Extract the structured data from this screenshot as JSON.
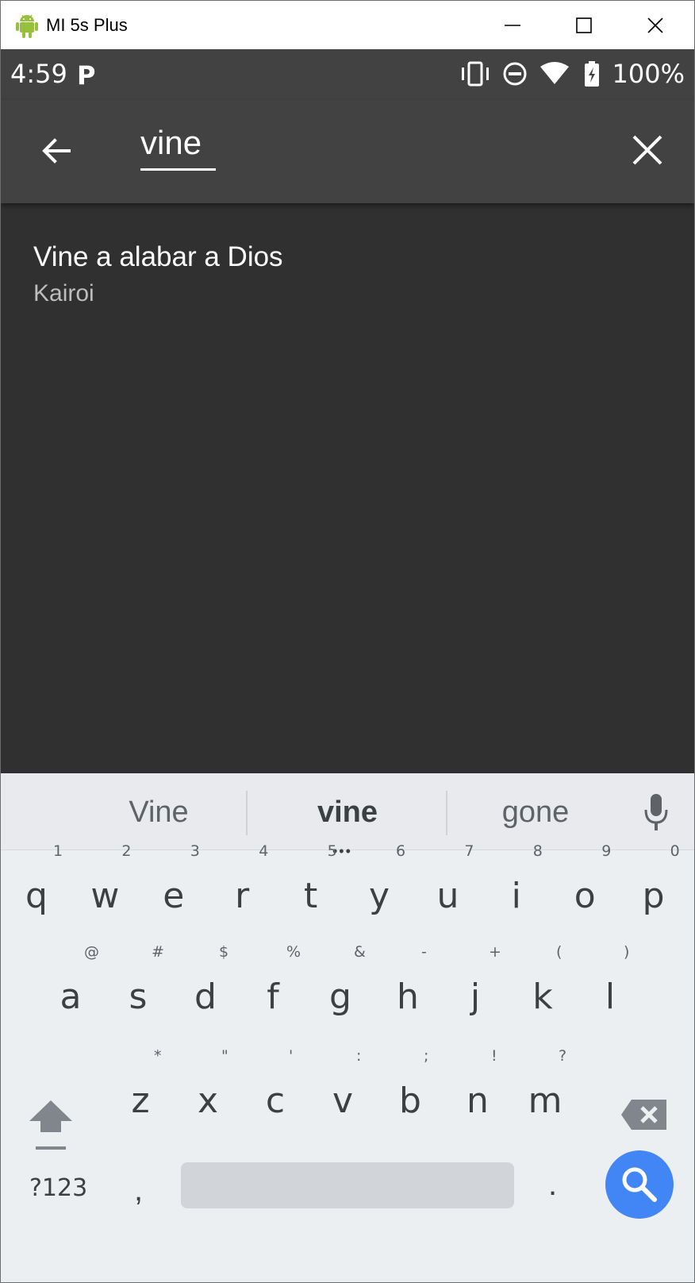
{
  "window": {
    "title": "MI 5s Plus",
    "icon": "android-icon",
    "controls": [
      "minimize-icon",
      "maximize-icon",
      "close-icon"
    ]
  },
  "status_bar": {
    "time": "4:59",
    "badge": "P",
    "icons": [
      "vibrate-icon",
      "do-not-disturb-icon",
      "wifi-icon",
      "battery-charging-icon"
    ],
    "battery": "100%"
  },
  "app_bar": {
    "query": "vine",
    "back_icon": "arrow-back-icon",
    "clear_icon": "close-icon",
    "background": "#424242"
  },
  "results": [
    {
      "title": "Vine a alabar a Dios",
      "subtitle": "Kairoi"
    }
  ],
  "content_background": "#303030",
  "keyboard": {
    "suggestions": [
      "Vine",
      "vine",
      "gone"
    ],
    "selected_suggestion": "vine",
    "more_indicator": "•••",
    "mic_icon": "microphone-icon",
    "row1": [
      {
        "key": "q",
        "hint": "1"
      },
      {
        "key": "w",
        "hint": "2"
      },
      {
        "key": "e",
        "hint": "3"
      },
      {
        "key": "r",
        "hint": "4"
      },
      {
        "key": "t",
        "hint": "5"
      },
      {
        "key": "y",
        "hint": "6"
      },
      {
        "key": "u",
        "hint": "7"
      },
      {
        "key": "i",
        "hint": "8"
      },
      {
        "key": "o",
        "hint": "9"
      },
      {
        "key": "p",
        "hint": "0"
      }
    ],
    "row2": [
      {
        "key": "a",
        "hint": "@"
      },
      {
        "key": "s",
        "hint": "#"
      },
      {
        "key": "d",
        "hint": "$"
      },
      {
        "key": "f",
        "hint": "%"
      },
      {
        "key": "g",
        "hint": "&"
      },
      {
        "key": "h",
        "hint": "-"
      },
      {
        "key": "j",
        "hint": "+"
      },
      {
        "key": "k",
        "hint": "("
      },
      {
        "key": "l",
        "hint": ")"
      }
    ],
    "row3": [
      {
        "key": "z",
        "hint": "*"
      },
      {
        "key": "x",
        "hint": "\""
      },
      {
        "key": "c",
        "hint": "'"
      },
      {
        "key": "v",
        "hint": ":"
      },
      {
        "key": "b",
        "hint": ";"
      },
      {
        "key": "n",
        "hint": "!"
      },
      {
        "key": "m",
        "hint": "?"
      }
    ],
    "shift_icon": "shift-icon",
    "backspace_icon": "backspace-icon",
    "symbols_label": "?123",
    "comma": ",",
    "period": ".",
    "search_icon": "search-icon",
    "search_color": "#4285f4"
  }
}
